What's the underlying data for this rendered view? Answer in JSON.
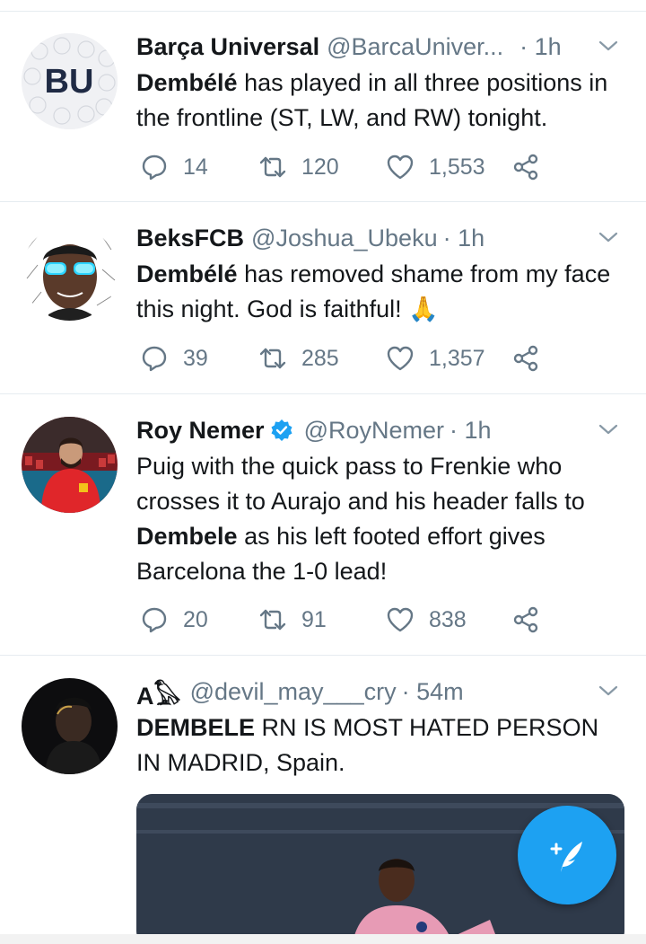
{
  "tweets": [
    {
      "name": "Barça Universal",
      "handle": "@BarcaUniver...",
      "time": "· 1h",
      "avatar_text": "BU",
      "text_bold": "Dembélé",
      "text_rest": " has played in all three positions in the frontline (ST, LW, and RW) tonight.",
      "replies": "14",
      "retweets": "120",
      "likes": "1,553"
    },
    {
      "name": "BeksFCB",
      "handle": "@Joshua_Ubeku",
      "time": "· 1h",
      "text_bold": "Dembélé",
      "text_rest": " has removed shame from my face this night. God is faithful! 🙏",
      "replies": "39",
      "retweets": "285",
      "likes": "1,357"
    },
    {
      "name": "Roy Nemer",
      "handle": "@RoyNemer",
      "time": "· 1h",
      "verified": true,
      "text_pre": "Puig with the quick pass to Frenkie who crosses it to Aurajo and his header falls to ",
      "text_bold": "Dembele",
      "text_rest": " as his left footed effort gives Barcelona the 1-0 lead!",
      "replies": "20",
      "retweets": "91",
      "likes": "838"
    },
    {
      "name": "A𓅃",
      "handle": "@devil_may___cry",
      "time": "· 54m",
      "text_bold": "DEMBELE",
      "text_rest": " RN IS MOST HATED PERSON IN MADRID, Spain."
    }
  ],
  "colors": {
    "accent": "#1da1f2",
    "muted": "#657786",
    "text": "#14171a",
    "divider": "#e6ecf0"
  },
  "icons": {
    "reply": "reply-icon",
    "retweet": "retweet-icon",
    "like": "like-icon",
    "share": "share-icon",
    "chevron": "chevron-down-icon",
    "verified": "verified-badge-icon",
    "compose": "compose-tweet-icon"
  }
}
